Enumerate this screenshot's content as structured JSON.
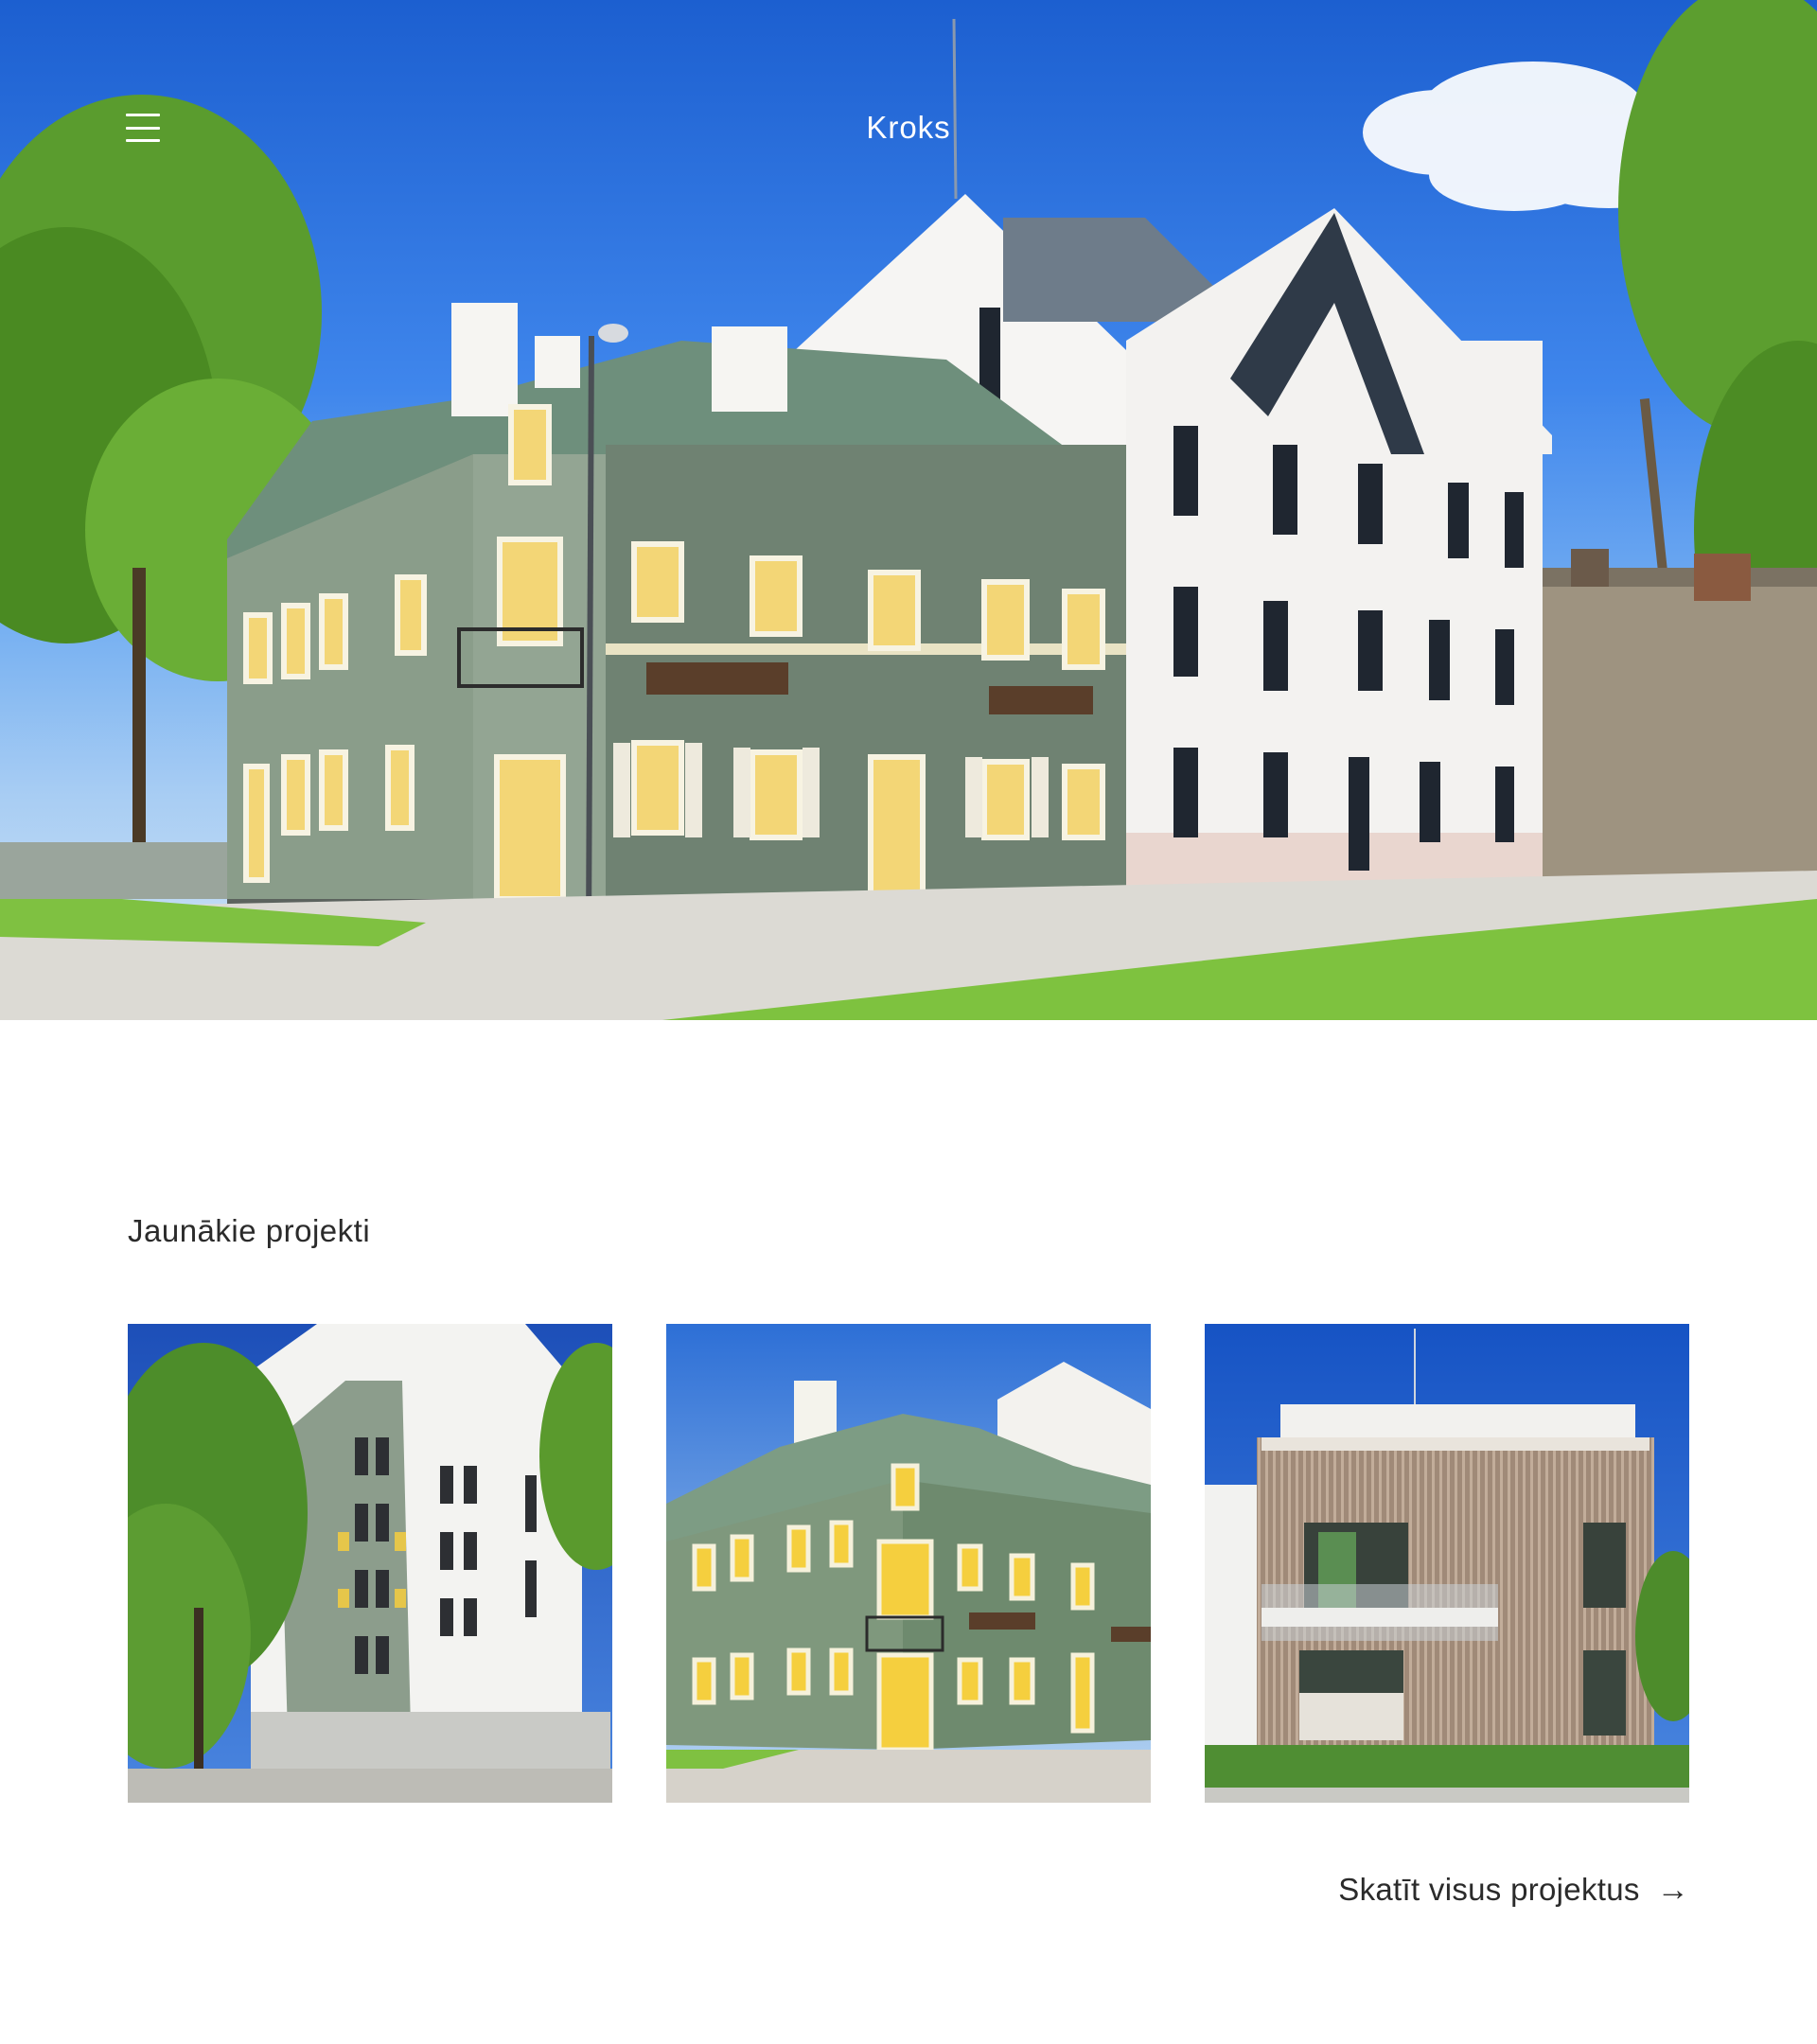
{
  "header": {
    "brand": "Kroks",
    "menu_icon": "hamburger-menu-icon"
  },
  "hero": {
    "image_subject": "two restored historic buildings, green wooden house and white plastered house"
  },
  "projects": {
    "title": "Jaunākie projekti",
    "items": [
      {
        "image_subject": "white and green corner apartment building"
      },
      {
        "image_subject": "green wooden house with yellow windows"
      },
      {
        "image_subject": "modern wood-slat clad building"
      }
    ],
    "view_all_label": "Skatīt visus projektus",
    "view_all_icon": "arrow-right-icon"
  },
  "colors": {
    "text": "#2b2b2b",
    "background": "#ffffff",
    "header_text": "#ffffff"
  }
}
